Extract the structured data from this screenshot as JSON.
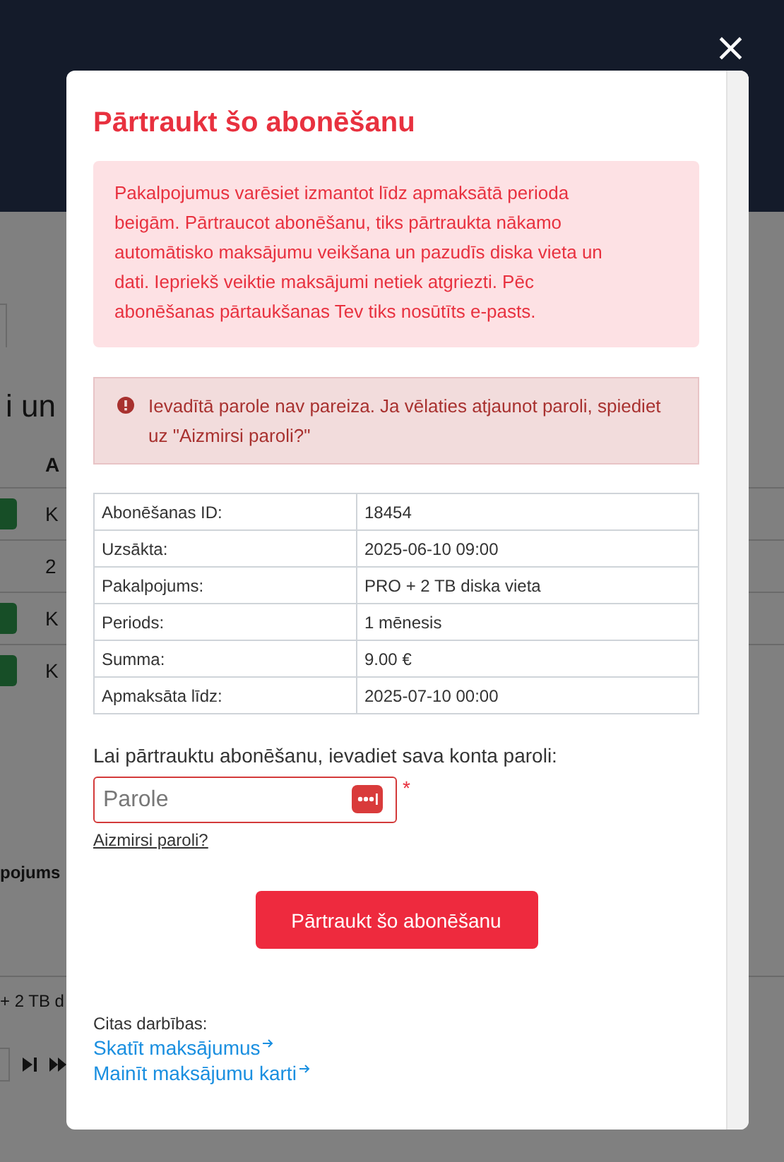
{
  "background": {
    "heading": "i un",
    "table_header": "A",
    "rows": [
      {
        "text": "K",
        "button": true
      },
      {
        "text": "2",
        "button": false
      },
      {
        "text": "K",
        "button": true
      },
      {
        "text": "K",
        "button": true
      }
    ],
    "second_header": "pojums",
    "second_row": "+ 2 TB d"
  },
  "modal": {
    "title": "Pārtraukt šo abonēšanu",
    "notice": "Pakalpojumus varēsiet izmantot līdz apmaksātā perioda beigām. Pārtraucot abonēšanu, tiks pārtraukta nākamo automātisko maksājumu veikšana un pazudīs diska vieta un dati. Iepriekš veiktie maksājumi netiek atgriezti. Pēc abonēšanas pārtaukšanas Tev tiks nosūtīts e-pasts.",
    "error": "Ievadītā parole nav pareiza. Ja vēlaties atjaunot paroli, spiediet uz \"Aizmirsi paroli?\"",
    "details": [
      {
        "label": "Abonēšanas ID:",
        "value": "18454"
      },
      {
        "label": "Uzsākta:",
        "value": "2025-06-10 09:00"
      },
      {
        "label": "Pakalpojums:",
        "value": "PRO + 2 TB diska vieta"
      },
      {
        "label": "Periods:",
        "value": "1 mēnesis"
      },
      {
        "label": "Summa:",
        "value": "9.00 €"
      },
      {
        "label": "Apmaksāta līdz:",
        "value": "2025-07-10 00:00"
      }
    ],
    "password_label": "Lai pārtrauktu abonēšanu, ievadiet sava konta paroli:",
    "password_placeholder": "Parole",
    "required_mark": "*",
    "forgot_link": "Aizmirsi paroli?",
    "submit": "Pārtraukt šo abonēšanu",
    "other_actions_label": "Citas darbības:",
    "links": [
      "Skatīt maksājumus",
      "Mainīt maksājumu karti"
    ],
    "close": "×"
  }
}
